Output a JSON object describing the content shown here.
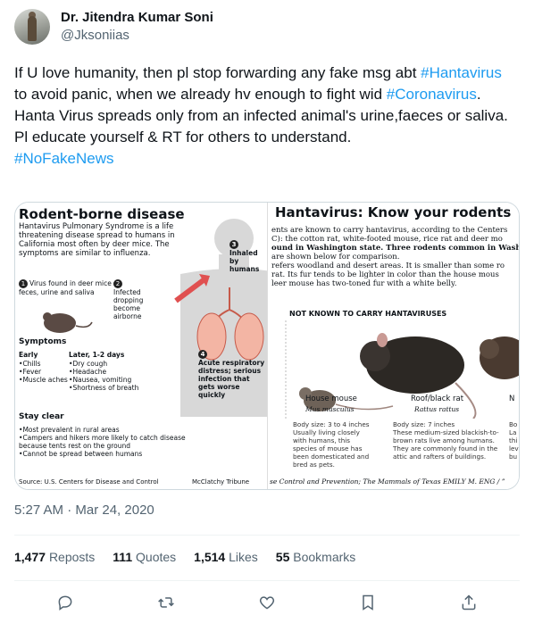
{
  "author": {
    "display_name": "Dr. Jitendra Kumar Soni",
    "handle": "@Jksoniias"
  },
  "tweet": {
    "line1_pre": "If U love humanity, then pl stop forwarding any fake msg abt ",
    "line1_tag": "#Hantavirus",
    "line2_pre": "to avoid panic, when we already hv enough to fight wid ",
    "line2_tag": "#Coronavirus",
    "line2_post": ".",
    "line3": "Hanta Virus spreads only from an infected animal's urine,faeces or saliva.",
    "line4": "Pl educate yourself & RT for others to understand.",
    "hashtag_end": "#NoFakeNews"
  },
  "image_left": {
    "title": "Rodent-borne disease",
    "intro": "Hantavirus Pulmonary Syndrome is a life threatening disease spread to humans in California most often by deer mice. The symptoms are similar to influenza.",
    "step1": "Virus found in deer mice feces, urine and saliva",
    "step2": "Infected dropping become airborne",
    "step3": "Inhaled by humans",
    "step4": "Acute respiratory distress; serious infection that gets worse quickly",
    "n1": "1",
    "n2": "2",
    "n3": "3",
    "n4": "4",
    "symptoms_title": "Symptoms",
    "early": "Early",
    "early_items": [
      "Chills",
      "Fever",
      "Muscle aches"
    ],
    "later": "Later, 1-2 days",
    "later_items": [
      "Dry cough",
      "Headache",
      "Nausea, vomiting",
      "Shortness of breath"
    ],
    "stay_clear": "Stay clear",
    "clear_items": [
      "Most prevalent in rural areas",
      "Campers and hikers more likely to catch disease because tents rest on the ground",
      "Cannot be spread between humans"
    ],
    "source": "Source: U.S. Centers for Disease and Control",
    "credit": "McClatchy Tribune"
  },
  "image_right": {
    "title": "Hantavirus: Know your rodents",
    "intro_lines": [
      "ents are known to carry hantavirus, according to the Centers",
      "C): the cotton rat, white-footed mouse, rice rat and deer mo",
      "ound in Washington state. Three rodents common in Wash",
      "are shown below for comparison.",
      "refers woodland and desert areas. It is smaller than some ro",
      "rat. Its fur tends to be lighter in color than the house mous",
      "leer mouse has two-toned fur with a white belly."
    ],
    "subhead": "NOT KNOWN TO CARRY HANTAVIRUSES",
    "rodents": [
      {
        "name": "House mouse",
        "sci": "Mus musculus",
        "desc": "Body size: 3 to 4 inches\nUsually living closely with humans, this species of mouse has been domesticated and bred as pets."
      },
      {
        "name": "Roof/black rat",
        "sci": "Rattus rattus",
        "desc": "Body size: 7 inches\nThese medium-sized blackish-to-brown rats live among humans. They are commonly found in the attic and rafters of buildings."
      },
      {
        "name": "N",
        "sci": "",
        "desc": "Bo\nLa\nthi\nlev\nbu"
      }
    ],
    "footer": "se Control and Prevention; The Mammals of Texas   EMILY M. ENG / ”"
  },
  "timestamp": "5:27 AM · Mar 24, 2020",
  "stats": [
    {
      "count": "1,477",
      "label": "Reposts"
    },
    {
      "count": "111",
      "label": "Quotes"
    },
    {
      "count": "1,514",
      "label": "Likes"
    },
    {
      "count": "55",
      "label": "Bookmarks"
    }
  ],
  "colors": {
    "link": "#1d9bf0",
    "muted": "#536471",
    "text": "#0f1419",
    "divider": "#eff3f4"
  },
  "icons": [
    "reply-icon",
    "repost-icon",
    "like-icon",
    "bookmark-icon",
    "share-icon"
  ]
}
